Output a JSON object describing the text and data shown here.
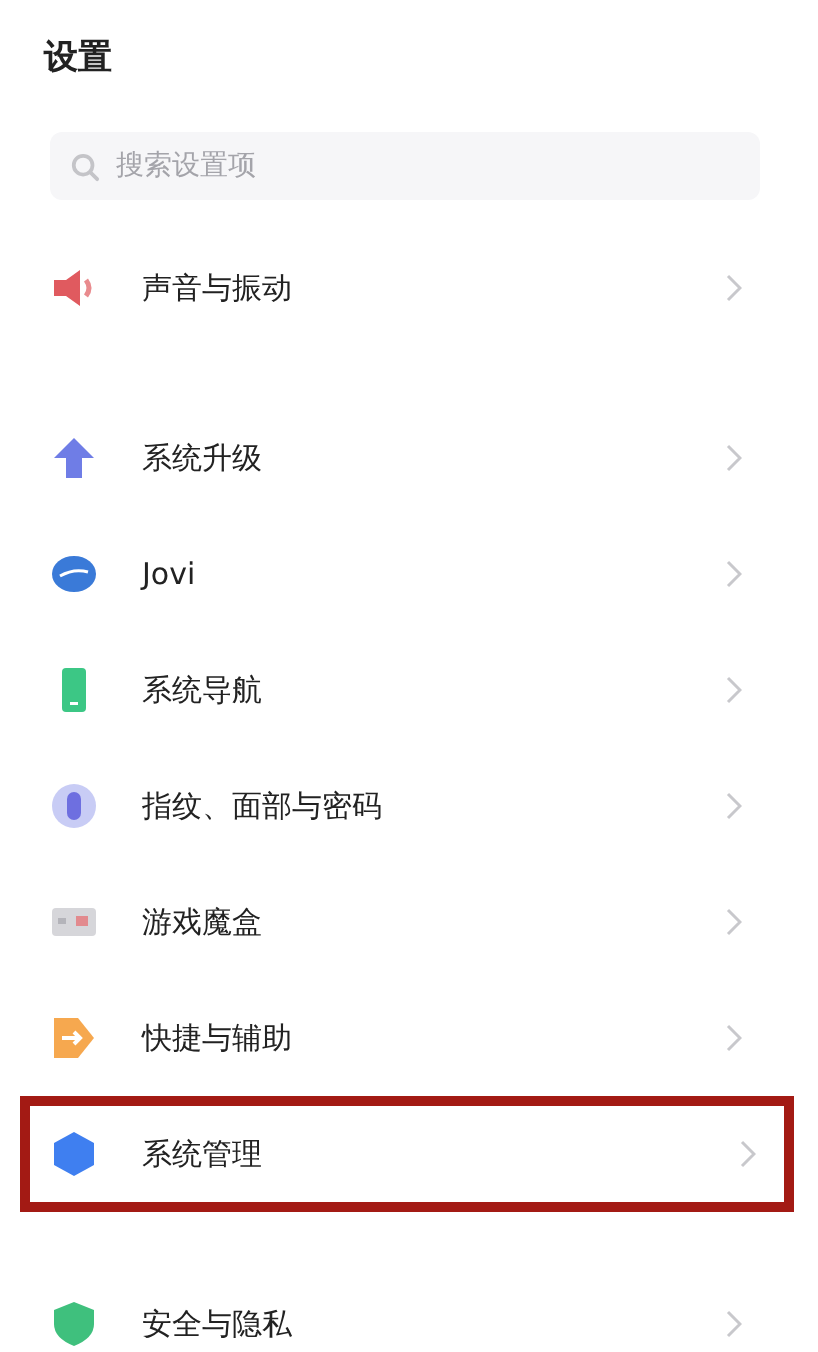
{
  "title": "设置",
  "search": {
    "placeholder": "搜索设置项"
  },
  "groups": [
    {
      "items": [
        {
          "label": "声音与振动",
          "highlighted": false
        }
      ]
    },
    {
      "items": [
        {
          "label": "系统升级",
          "highlighted": false
        },
        {
          "label": "Jovi",
          "highlighted": false
        },
        {
          "label": "系统导航",
          "highlighted": false
        },
        {
          "label": "指纹、面部与密码",
          "highlighted": false
        },
        {
          "label": "游戏魔盒",
          "highlighted": false
        },
        {
          "label": "快捷与辅助",
          "highlighted": false
        },
        {
          "label": "系统管理",
          "highlighted": true
        }
      ]
    },
    {
      "items": [
        {
          "label": "安全与隐私",
          "highlighted": false
        }
      ]
    }
  ]
}
